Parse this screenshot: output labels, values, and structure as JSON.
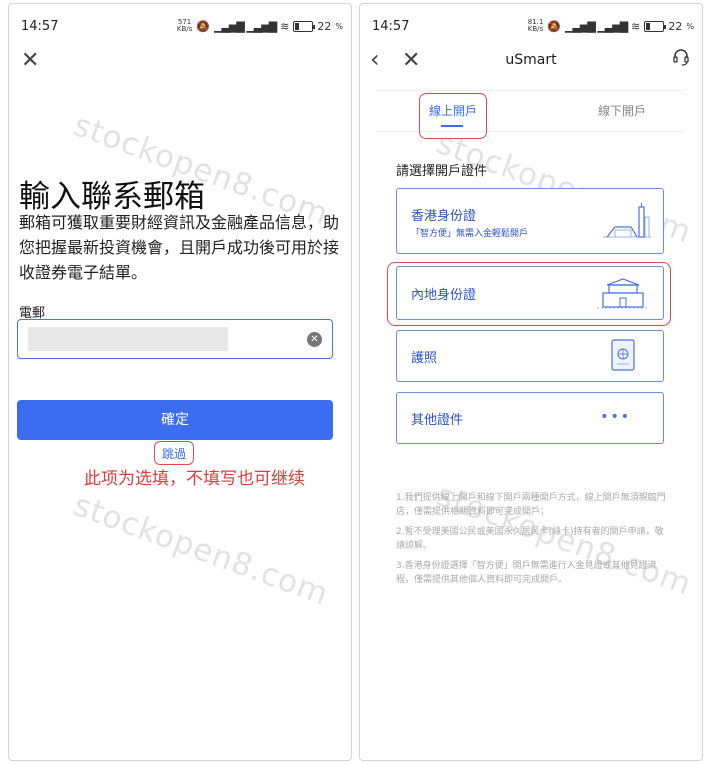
{
  "left_screen": {
    "status": {
      "time": "14:57",
      "net_speed": "571\nKB/s",
      "battery": "22"
    },
    "title": "輸入聯系郵箱",
    "description": "郵箱可獲取重要財經資訊及金融產品信息，助您把握最新投資機會，且開戶成功後可用於接收證券電子結單。",
    "email_label": "電郵",
    "confirm_label": "確定",
    "skip_label": "跳過",
    "annotation": "此项为选填，不填写也可继续"
  },
  "right_screen": {
    "status": {
      "time": "14:57",
      "net_speed": "81.1\nKB/s",
      "battery": "22"
    },
    "nav_title": "uSmart",
    "tabs": [
      {
        "label": "線上開戶",
        "active": true
      },
      {
        "label": "線下開戶",
        "active": false
      }
    ],
    "section_label": "請選擇開戶證件",
    "cards": [
      {
        "title": "香港身份證",
        "subtitle": "「智方便」無需入金輕鬆開戶",
        "icon": "hk-skyline-icon"
      },
      {
        "title": "內地身份證",
        "icon": "tiananmen-icon"
      },
      {
        "title": "護照",
        "icon": "passport-icon"
      },
      {
        "title": "其他證件",
        "icon": "more-dots-icon"
      }
    ],
    "notes": [
      "1.我們提供線上開戶和線下開戶兩種開戶方式，線上開戶無須親臨門店，僅需提供相關資料即可完成開戶；",
      "2.暫不受理美國公民或美國永久居民卡(綠卡)持有者的開戶申請，敬請諒解。",
      "3.香港身份證選擇「智方便」開戶無需進行入金見證或其他見證流程，僅需提供其他個人資料即可完成開戶。"
    ]
  },
  "watermark": "stockopen8.com",
  "colors": {
    "accent": "#3a6df0",
    "highlight": "#e24a4a",
    "annotation": "#e23b3b"
  }
}
